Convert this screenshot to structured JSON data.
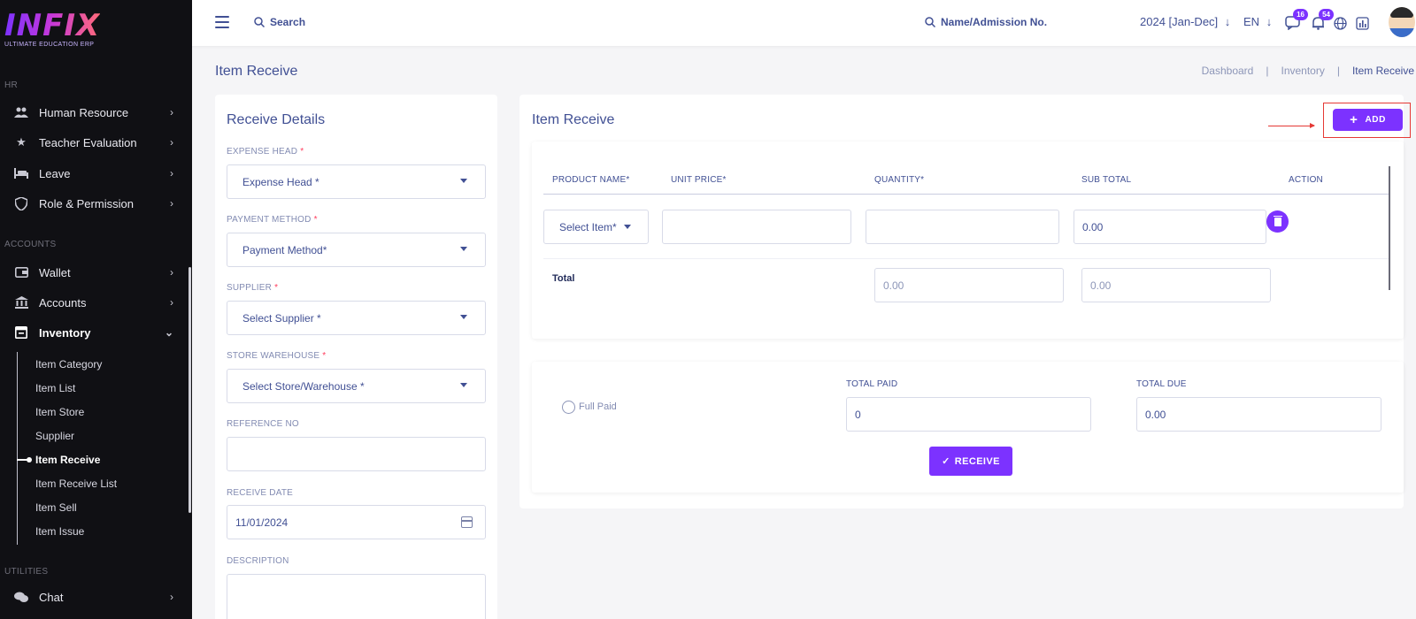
{
  "brand": {
    "name": "INFIX",
    "tagline": "ULTIMATE EDUCATION ERP"
  },
  "sidebar": {
    "sections": {
      "hr": "HR",
      "accounts": "ACCOUNTS",
      "utilities": "UTILITIES"
    },
    "items": [
      {
        "label": "Human Resource",
        "icon": "users-icon"
      },
      {
        "label": "Teacher Evaluation",
        "icon": "star-icon"
      },
      {
        "label": "Leave",
        "icon": "bed-icon"
      },
      {
        "label": "Role & Permission",
        "icon": "shield-icon"
      },
      {
        "label": "Wallet",
        "icon": "wallet-icon"
      },
      {
        "label": "Accounts",
        "icon": "bank-icon"
      },
      {
        "label": "Inventory",
        "icon": "inventory-icon"
      },
      {
        "label": "Chat",
        "icon": "chat-icon"
      }
    ],
    "inventory_sub": [
      "Item Category",
      "Item List",
      "Item Store",
      "Supplier",
      "Item Receive",
      "Item Receive List",
      "Item Sell",
      "Item Issue"
    ]
  },
  "topbar": {
    "search_label": "Search",
    "admission_search": "Name/Admission No.",
    "session": "2024 [Jan-Dec]",
    "language": "EN",
    "message_count": "16",
    "notification_count": "54"
  },
  "page": {
    "title": "Item Receive",
    "breadcrumb": [
      "Dashboard",
      "Inventory",
      "Item Receive"
    ]
  },
  "receive_details": {
    "title": "Receive Details",
    "expense_head_label": "EXPENSE HEAD",
    "expense_head_value": "Expense Head *",
    "payment_method_label": "PAYMENT METHOD",
    "payment_method_value": "Payment Method*",
    "supplier_label": "SUPPLIER",
    "supplier_value": "Select Supplier *",
    "store_label": "STORE WAREHOUSE",
    "store_value": "Select Store/Warehouse *",
    "reference_label": "REFERENCE NO",
    "reference_value": "",
    "date_label": "RECEIVE DATE",
    "date_value": "11/01/2024",
    "description_label": "DESCRIPTION",
    "required_mark": "*"
  },
  "item_receive": {
    "title": "Item Receive",
    "add_label": "ADD",
    "columns": [
      "PRODUCT NAME*",
      "UNIT PRICE*",
      "QUANTITY*",
      "SUB TOTAL",
      "ACTION"
    ],
    "row": {
      "product": "Select Item*",
      "unit_price": "",
      "quantity": "",
      "sub_total": "0.00"
    },
    "total_label": "Total",
    "total_quantity": "0.00",
    "total_sub": "0.00"
  },
  "payment": {
    "full_paid_label": "Full Paid",
    "total_paid_label": "TOTAL PAID",
    "total_paid_value": "0",
    "total_due_label": "TOTAL DUE",
    "total_due_value": "0.00",
    "receive_label": "RECEIVE"
  },
  "colors": {
    "primary": "#7c32ff",
    "text": "#415094",
    "sidebar_bg": "#101014",
    "highlight": "#e53935"
  }
}
